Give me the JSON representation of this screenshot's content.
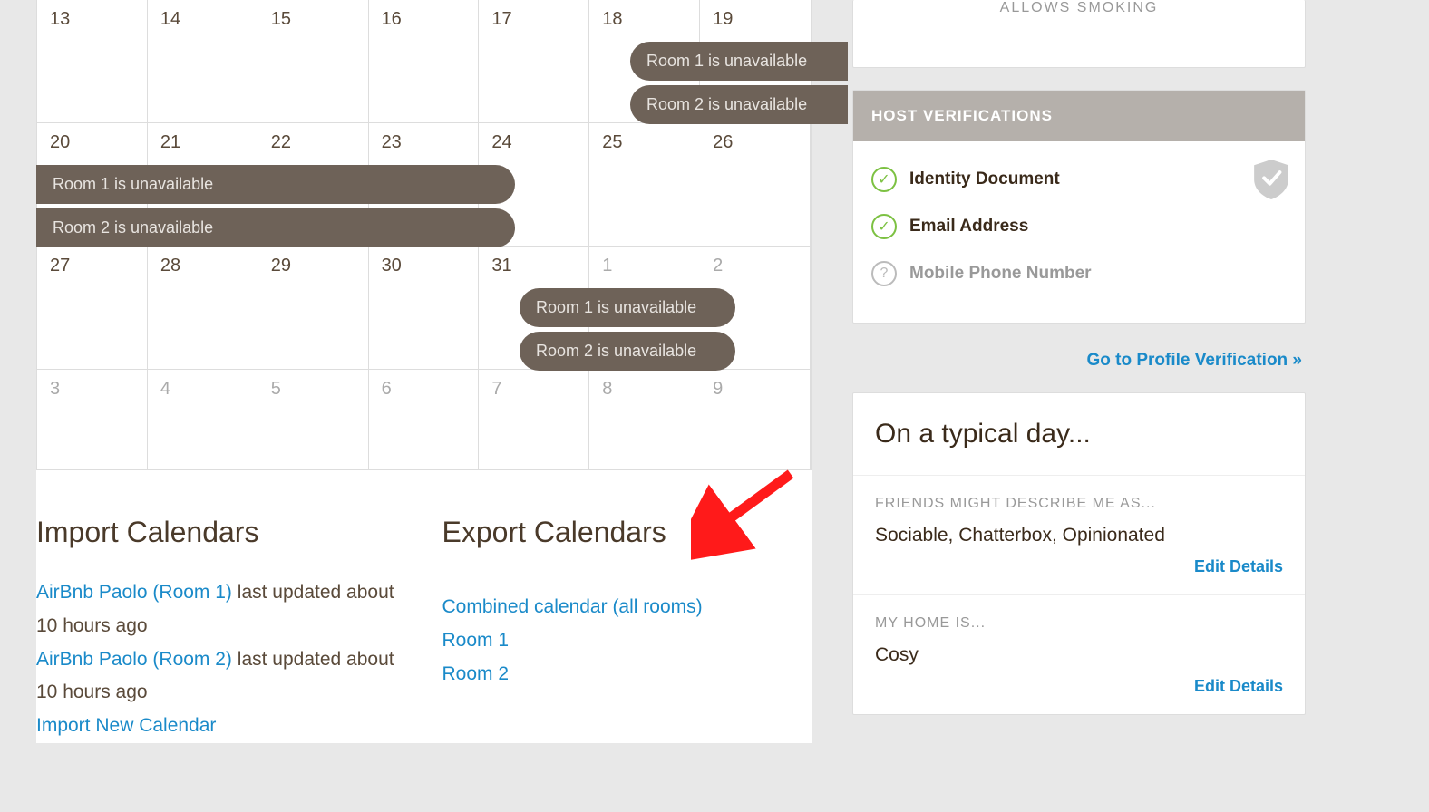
{
  "calendar": {
    "weeks": [
      {
        "days": [
          "13",
          "14",
          "15",
          "16",
          "17",
          "18",
          "19"
        ],
        "muted": [
          false,
          false,
          false,
          false,
          false,
          false,
          false
        ]
      },
      {
        "days": [
          "20",
          "21",
          "22",
          "23",
          "24",
          "25",
          "26"
        ],
        "muted": [
          false,
          false,
          false,
          false,
          false,
          false,
          false
        ]
      },
      {
        "days": [
          "27",
          "28",
          "29",
          "30",
          "31",
          "1",
          "2"
        ],
        "muted": [
          false,
          false,
          false,
          false,
          false,
          true,
          true
        ]
      },
      {
        "days": [
          "3",
          "4",
          "5",
          "6",
          "7",
          "8",
          "9"
        ],
        "muted": [
          true,
          true,
          true,
          true,
          true,
          true,
          true
        ]
      }
    ],
    "events": {
      "room1": "Room 1 is unavailable",
      "room2": "Room 2 is unavailable"
    }
  },
  "import": {
    "heading": "Import Calendars",
    "items": [
      {
        "link": "AirBnb Paolo (Room 1)",
        "meta": "last updated about 10 hours ago"
      },
      {
        "link": "AirBnb Paolo (Room 2)",
        "meta": "last updated about 10 hours ago"
      }
    ],
    "new_link": "Import New Calendar"
  },
  "export": {
    "heading": "Export Calendars",
    "links": [
      "Combined calendar (all rooms)",
      "Room 1",
      "Room 2"
    ]
  },
  "smoking": "ALLOWS SMOKING",
  "verifications": {
    "header": "HOST VERIFICATIONS",
    "items": [
      {
        "label": "Identity Document",
        "ok": true
      },
      {
        "label": "Email Address",
        "ok": true
      },
      {
        "label": "Mobile Phone Number",
        "ok": false
      }
    ],
    "goto": "Go to Profile Verification »"
  },
  "typical": {
    "heading": "On a typical day...",
    "sections": [
      {
        "label": "FRIENDS MIGHT DESCRIBE ME AS...",
        "value": "Sociable, Chatterbox, Opinionated",
        "edit": "Edit Details"
      },
      {
        "label": "MY HOME IS...",
        "value": "Cosy",
        "edit": "Edit Details"
      }
    ]
  }
}
